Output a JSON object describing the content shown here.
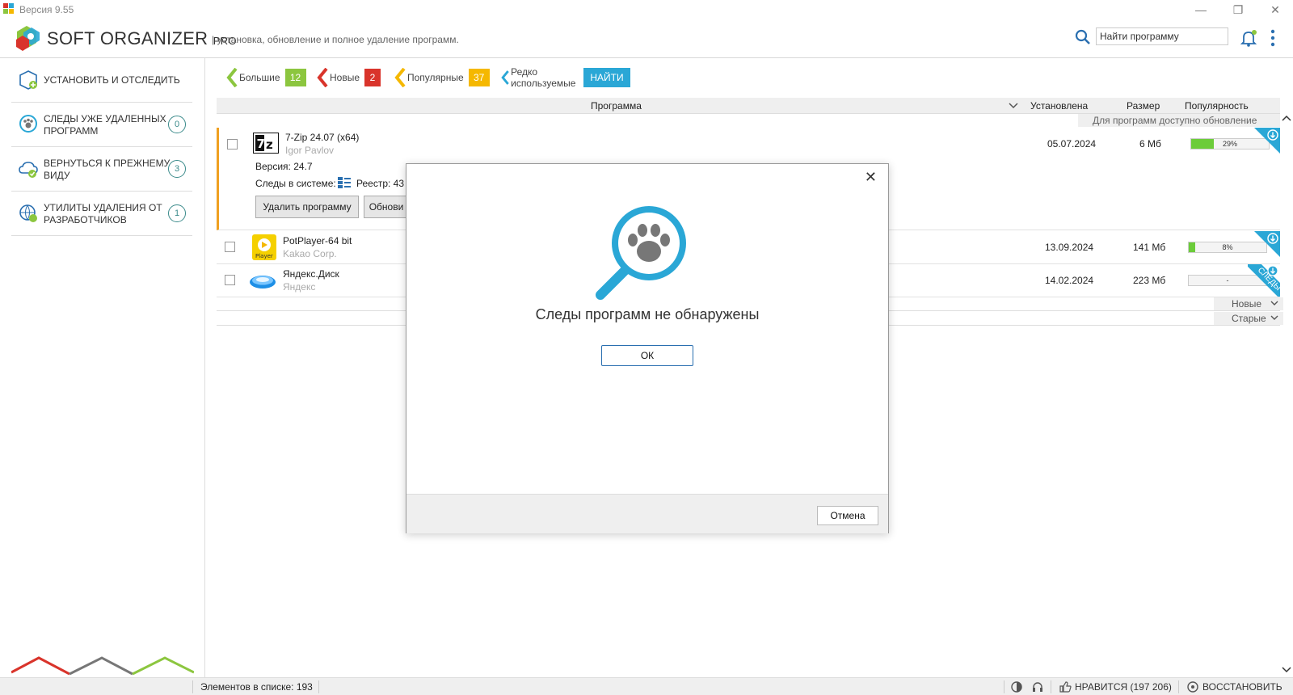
{
  "window": {
    "version": "Версия 9.55"
  },
  "header": {
    "brand": "SOFT ORGANIZER",
    "brand_suffix": "PRO",
    "subtitle": "| установка, обновление и полное удаление программ.",
    "search_placeholder": "Найти программу"
  },
  "sidebar": {
    "items": [
      {
        "label": "УСТАНОВИТЬ И ОТСЛЕДИТЬ",
        "count": null
      },
      {
        "label": "СЛЕДЫ УЖЕ УДАЛЕННЫХ ПРОГРАММ",
        "count": "0"
      },
      {
        "label": "ВЕРНУТЬСЯ К ПРЕЖНЕМУ ВИДУ",
        "count": "3"
      },
      {
        "label": "УТИЛИТЫ УДАЛЕНИЯ ОТ РАЗРАБОТЧИКОВ",
        "count": "1"
      }
    ]
  },
  "filters": [
    {
      "label": "Большие",
      "count": "12",
      "color": "#8cc63f"
    },
    {
      "label": "Новые",
      "count": "2",
      "color": "#d9342b"
    },
    {
      "label": "Популярные",
      "count": "37",
      "color": "#f5b800"
    },
    {
      "label": "Редко используемые",
      "action": "НАЙТИ",
      "color": "#2aa7d6"
    }
  ],
  "table": {
    "columns": {
      "program": "Программа",
      "installed": "Установлена",
      "size": "Размер",
      "popularity": "Популярность"
    },
    "update_note": "Для программ доступно обновление",
    "rows": [
      {
        "name": "7-Zip 24.07 (x64)",
        "vendor": "Igor Pavlov",
        "date": "05.07.2024",
        "size": "6 Мб",
        "popularity": 0.29,
        "popularity_label": "29%",
        "version_label": "Версия: 24.7",
        "traces_label": "Следы в системе:",
        "registry_label": "Реестр: 43",
        "uninstall_label": "Удалить программу",
        "update_label": "Обнови"
      },
      {
        "name": "PotPlayer-64 bit",
        "vendor": "Kakao Corp.",
        "date": "13.09.2024",
        "size": "141 Мб",
        "popularity": 0.08,
        "popularity_label": "8%"
      },
      {
        "name": "Яндекс.Диск",
        "vendor": "Яндекс",
        "date": "14.02.2024",
        "size": "223 Мб",
        "popularity": 0,
        "popularity_label": "-",
        "ribbon": "СЛЕДЫ"
      }
    ],
    "sort_new": "Новые",
    "sort_old": "Старые"
  },
  "dialog": {
    "message": "Следы программ не обнаружены",
    "ok": "ОК",
    "cancel": "Отмена"
  },
  "statusbar": {
    "count": "Элементов в списке: 193",
    "likes": "НРАВИТСЯ (197 206)",
    "restore": "ВОССТАНОВИТЬ"
  }
}
